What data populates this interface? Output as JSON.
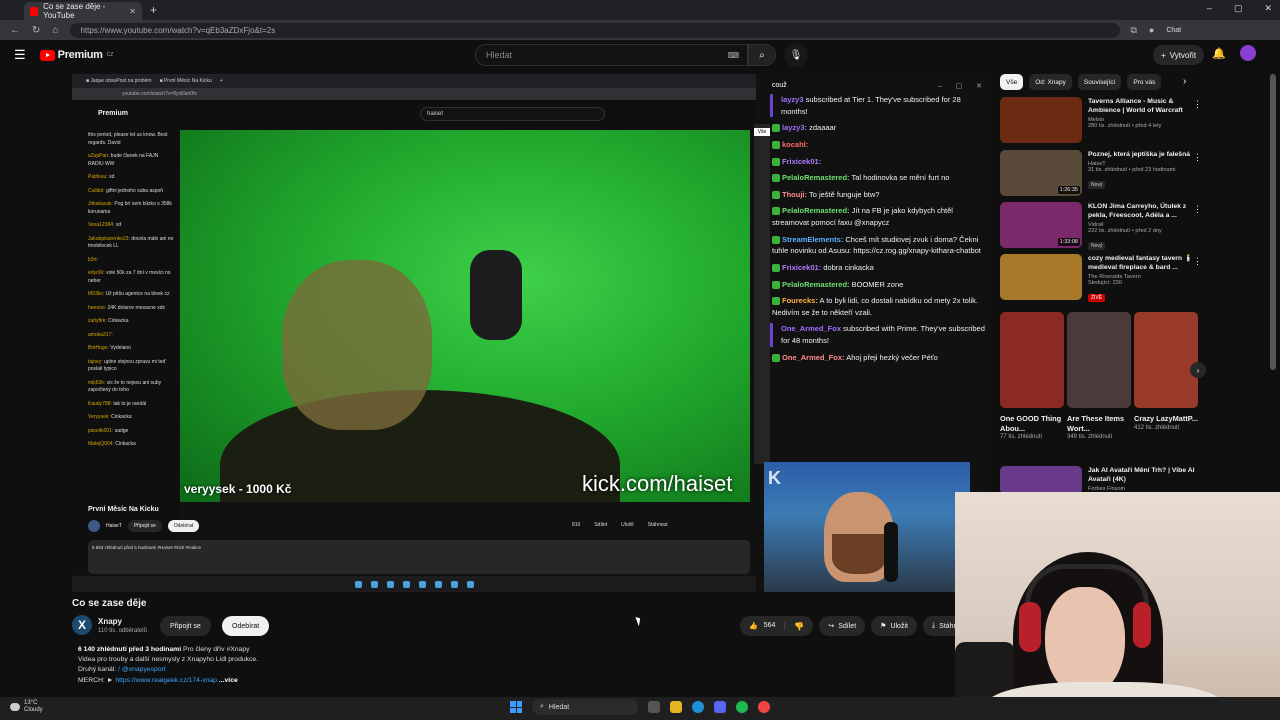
{
  "browser": {
    "tab_title": "Co se zase děje - YouTube",
    "url": "https://www.youtube.com/watch?v=qEb3aZDxFjo&t=2s",
    "chat_ext": "Chat"
  },
  "header": {
    "logo": "Premium",
    "logo_country": "CZ",
    "search_placeholder": "Hledat",
    "create_label": "Vytvořit"
  },
  "stream": {
    "inner_search": "haiset",
    "inner_logo": "Premium",
    "cam_label": "veryysek - 1000 Kč",
    "cam_url": "kick.com/haiset",
    "inner_title": "První Měsíc Na Kicku",
    "inner_channel": "HaiseT",
    "inner_join": "Připojit se",
    "inner_sub": "Odebírat",
    "inner_actions": [
      "810",
      "Sdílet",
      "Uložit",
      "Stáhnout"
    ],
    "inner_desc": "9 593 zhlédnutí před 5 hodinami #Haiset #kick #malice",
    "inner_chat": [
      {
        "u": "",
        "t": "this period, please let us know. Best regards. David"
      },
      {
        "u": "sZupPan:",
        "t": "bude članek na FAJN RADIU WW"
      },
      {
        "u": "Patrikuu:",
        "t": "xd"
      },
      {
        "u": "Cuildol:",
        "t": "giftni jednoho suba aspoň"
      },
      {
        "u": "Jirkakacak:",
        "t": "Pog brí sem blízko s 358k korunama"
      },
      {
        "u": "Vesa12384:",
        "t": "xd"
      },
      {
        "u": "Jakubpisarenko23:",
        "t": "docela málo ani ne tmobilecek LL"
      },
      {
        "u": "b3rt:",
        "t": ""
      },
      {
        "u": "erlyr00:",
        "t": "vole 50k za 7 dní v mesíci no neber"
      },
      {
        "u": "M93ks:",
        "t": "Už pěšu agentce na blesk cz"
      },
      {
        "u": "heeooo:",
        "t": "24K dolarov mesacne xdx"
      },
      {
        "u": "zarlyfirk:",
        "t": "Cinkacka"
      },
      {
        "u": "amoka317:",
        "t": ""
      },
      {
        "u": "BotHugo:",
        "t": "Vydelano"
      },
      {
        "u": "tajney:",
        "t": "uplne stejnou zpravu mi teď poslali typico"
      },
      {
        "u": "mik63k:",
        "t": "vis že to nejsou ani suby započtený do toho"
      },
      {
        "u": "Kaudy788:",
        "t": "tak to je randál"
      },
      {
        "u": "Veryysek:",
        "t": "Cinkacka"
      },
      {
        "u": "pavelik001:",
        "t": "sadge"
      },
      {
        "u": "MatejQ004:",
        "t": "Cinkacka"
      }
    ]
  },
  "kick_chat": {
    "header": "couž",
    "messages": [
      {
        "type": "sub",
        "name": "layzy3",
        "text": "subscribed at Tier 1. They've subscribed for 28 months!"
      },
      {
        "type": "msg",
        "name": "layzy3:",
        "text": "zdaaaar",
        "color": "#a070ff"
      },
      {
        "type": "msg",
        "name": "kocahl:",
        "text": "",
        "color": "#ff6a6a"
      },
      {
        "type": "msg",
        "name": "Frixicek01:",
        "text": "",
        "color": "#b07aff"
      },
      {
        "type": "msg",
        "name": "PelaloRemastered:",
        "text": "Tal hodinovka se mění furt no",
        "color": "#6ee06e"
      },
      {
        "type": "msg",
        "name": "Thouji:",
        "text": "To ještě funguje btw?",
        "color": "#ff8b8b"
      },
      {
        "type": "msg",
        "name": "PelaloRemastered:",
        "text": "Jít na FB je jako kdybych chtěl streamovat pomocí faxu @xnapycz",
        "color": "#6ee06e"
      },
      {
        "type": "msg",
        "name": "StreamElements:",
        "text": "Chceš mít studiovej zvuk i doma? Čekni tuhle novinku od Asusu: https://cz.rog.gg/xnapy-kithara-chatbot",
        "color": "#5ab0ff"
      },
      {
        "type": "msg",
        "name": "Frixicek01:",
        "text": "dobra cinkacka",
        "color": "#b07aff"
      },
      {
        "type": "msg",
        "name": "PelaloRemastered:",
        "text": "BOOMER zone",
        "color": "#6ee06e"
      },
      {
        "type": "msg",
        "name": "Fourecks:",
        "text": "A to byli lidi, co dostali nabídku od mety 2x tolik. Nedivím se že to někteří vzali.",
        "color": "#ffb347"
      },
      {
        "type": "sub",
        "name": "One_Armed_Fox",
        "text": "subscribed with Prime. They've subscribed for 48 months!"
      },
      {
        "type": "msg",
        "name": "One_Armed_Fox:",
        "text": "Ahoj přeji hezký večer Péťo",
        "color": "#ff8b8b"
      }
    ],
    "side_chip": "Vše"
  },
  "video": {
    "title": "Co se zase děje",
    "channel_initial": "X",
    "channel": "Xnapy",
    "subs": "110 tis. odběratelů",
    "join": "Připojit se",
    "subscribe": "Odebírat",
    "likes": "564",
    "share": "Sdílet",
    "save": "Uložit",
    "download": "Stáhno",
    "desc_meta": "6 140 zhlédnutí  před 3 hodinami",
    "desc_members": "Pro členy dřív  #Xnapy",
    "desc_line1": "Videa pro trouby a další nesmysly z Xnapyho Lidl produkce.",
    "desc_line2": "Druhý kanál:",
    "desc_link2": "/ @xnapyesport",
    "desc_line3": "MERCH: ►",
    "desc_link3": "https://www.realgeek.cz/174-xnap",
    "desc_more": "...více"
  },
  "recs": {
    "chips": [
      "Vše",
      "Od: Xnapy",
      "Související",
      "Pro vás"
    ],
    "items": [
      {
        "title": "Taverns Alliance - Music & Ambience | World of Warcraft",
        "channel": "Melsio",
        "meta": "280 tis. zhlédnutí • před 4 lety",
        "duration": "",
        "badge": "",
        "color": "#6b2a12"
      },
      {
        "title": "Poznej, která jeptiška je falešná",
        "channel": "HaiseT",
        "meta": "31 tis. zhlédnutí • před 23 hodinami",
        "duration": "1:26:35",
        "badge": "Nový",
        "color": "#5a4a3a"
      },
      {
        "title": "KLON Jima Carreyho, Útulek z pekla, Freescoot, Adéla a ...",
        "channel": "Vidrail",
        "meta": "222 tis. zhlédnutí • před 2 dny",
        "duration": "1:33:08",
        "badge": "Nový",
        "color": "#7a2a6a"
      },
      {
        "title": "cozy medieval fantasy tavern 🕯️ medieval fireplace & bard ...",
        "channel": "The Riverside Tavern",
        "meta": "Sledující: 230",
        "duration": "",
        "badge": "ŽIVĚ",
        "color": "#a8782a"
      }
    ],
    "shorts": [
      {
        "title": "One GOOD Thing Abou...",
        "views": "77 tis. zhlédnutí",
        "color": "#8a2a22"
      },
      {
        "title": "Are These Items Wort...",
        "views": "349 tis. zhlédnutí",
        "color": "#4a3a3a"
      },
      {
        "title": "Crazy LazyMattP...",
        "views": "412 tis. zhlédnutí",
        "color": "#9a3a2a"
      }
    ],
    "extra": {
      "title": "Jak AI Avataři Mění Trh? | Vibe AI Avataři (4K)",
      "channel": "Forbes Finsoin",
      "color": "#6a3a8a"
    }
  },
  "taskbar": {
    "temp": "13°C",
    "weather": "Cloudy",
    "search": "Hledat"
  }
}
